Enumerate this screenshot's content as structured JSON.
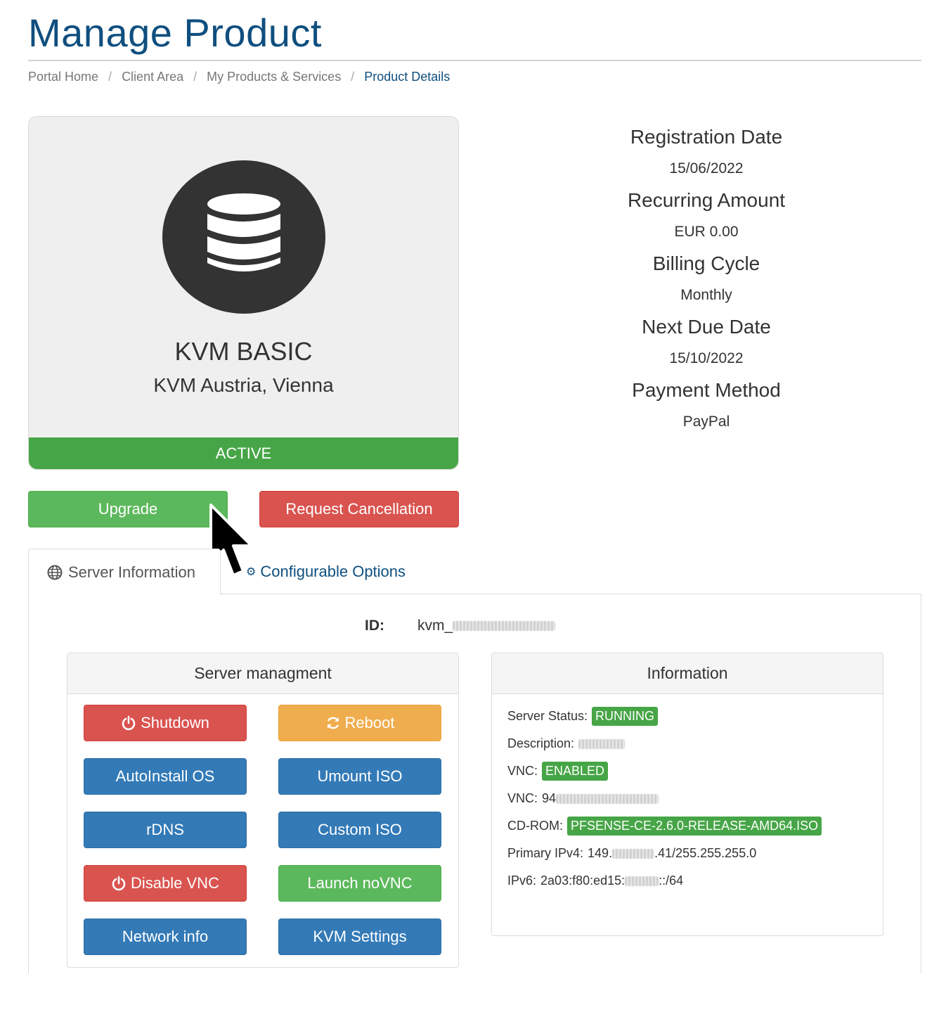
{
  "page": {
    "title": "Manage Product"
  },
  "breadcrumb": [
    "Portal Home",
    "Client Area",
    "My Products & Services",
    "Product Details"
  ],
  "product": {
    "name": "KVM BASIC",
    "location": "KVM Austria, Vienna",
    "status": "ACTIVE",
    "icon": "database-icon"
  },
  "billing": [
    {
      "label": "Registration Date",
      "value": "15/06/2022"
    },
    {
      "label": "Recurring Amount",
      "value": "EUR 0.00"
    },
    {
      "label": "Billing Cycle",
      "value": "Monthly"
    },
    {
      "label": "Next Due Date",
      "value": "15/10/2022"
    },
    {
      "label": "Payment Method",
      "value": "PayPal"
    }
  ],
  "actions": {
    "upgrade": "Upgrade",
    "cancel": "Request Cancellation"
  },
  "tabs": {
    "server_info": "Server Information",
    "config_options": "Configurable Options"
  },
  "server": {
    "id_label": "ID:",
    "id_prefix": "kvm_"
  },
  "management": {
    "title": "Server managment",
    "buttons": {
      "shutdown": "Shutdown",
      "reboot": "Reboot",
      "autoinstall": "AutoInstall OS",
      "umount": "Umount ISO",
      "rdns": "rDNS",
      "custom_iso": "Custom ISO",
      "disable_vnc": "Disable VNC",
      "launch_novnc": "Launch noVNC",
      "network_info": "Network info",
      "kvm_settings": "KVM Settings"
    }
  },
  "information": {
    "title": "Information",
    "status_label": "Server Status:",
    "status_value": "RUNNING",
    "description_label": "Description:",
    "vnc_label": "VNC:",
    "vnc_value": "ENABLED",
    "vnc_addr_label": "VNC:",
    "vnc_addr_prefix": "94",
    "cdrom_label": "CD-ROM:",
    "cdrom_value": "PFSENSE-CE-2.6.0-RELEASE-AMD64.ISO",
    "ipv4_label": "Primary IPv4:",
    "ipv4_prefix": "149.",
    "ipv4_suffix": ".41/255.255.255.0",
    "ipv6_label": "IPv6:",
    "ipv6_prefix": "2a03:f80:ed15:",
    "ipv6_suffix": "::/64"
  },
  "colors": {
    "brand": "#0f4f7f",
    "success": "#46a546",
    "danger": "#d9534f",
    "warning": "#f0ad4e",
    "primary": "#337ab7"
  }
}
